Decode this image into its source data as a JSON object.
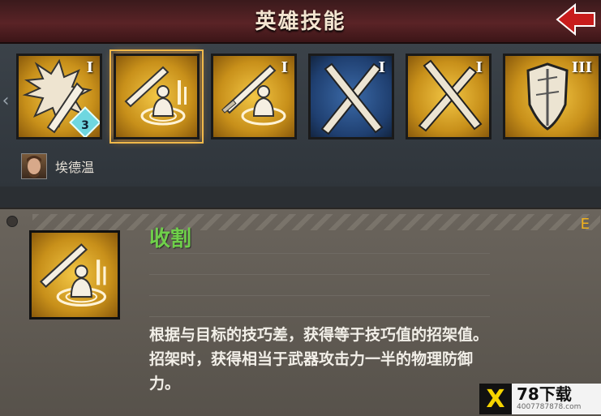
{
  "header": {
    "title": "英雄技能",
    "back_icon": "back-arrow-icon"
  },
  "skills": [
    {
      "name": "strike-burst-skill",
      "tier": "I",
      "level": "3",
      "bg": "gold"
    },
    {
      "name": "harvest-skill",
      "tier": "",
      "bg": "gold",
      "selected": true
    },
    {
      "name": "sword-guard-skill",
      "tier": "I",
      "bg": "gold"
    },
    {
      "name": "cross-blades-skill",
      "tier": "I",
      "bg": "blue"
    },
    {
      "name": "cross-swords-skill",
      "tier": "I",
      "bg": "gold"
    },
    {
      "name": "shield-skill",
      "tier": "III",
      "bg": "gold"
    }
  ],
  "hero": {
    "name": "埃德温"
  },
  "detail": {
    "skill_name": "收割",
    "key": "E",
    "description": "根据与目标的技巧差，获得等于技巧值的招架值。招架时，获得相当于武器攻击力一半的物理防御力。"
  },
  "watermark": {
    "logo": "X",
    "main": "78下载",
    "sub": "4007787878.com"
  },
  "colors": {
    "gold": "#e0ad2c",
    "blue": "#274f88",
    "accent_green": "#6fd04a",
    "header_red": "#5a2326"
  }
}
